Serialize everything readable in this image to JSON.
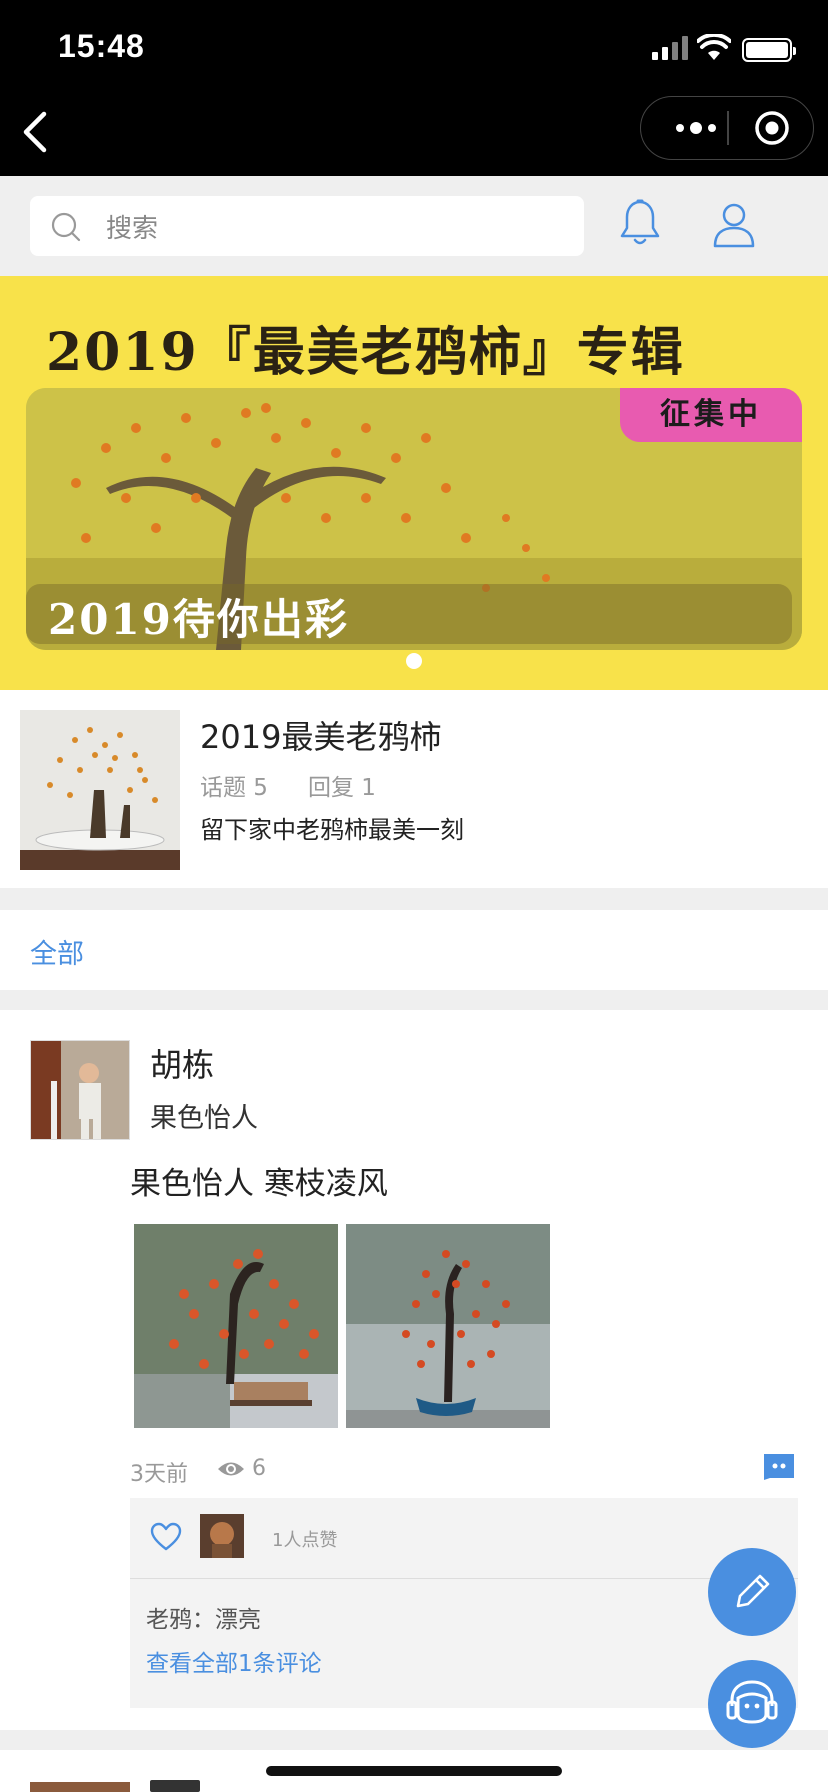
{
  "status_bar": {
    "time": "15:48"
  },
  "search": {
    "placeholder": "搜索"
  },
  "banner": {
    "title": "2019『最美老鸦柿』专辑",
    "tag": "征集中",
    "subtitle": "2019待你出彩"
  },
  "topic": {
    "title": "2019最美老鸦柿",
    "topics_label": "话题 5",
    "replies_label": "回复 1",
    "description": "留下家中老鸦柿最美一刻"
  },
  "filter": {
    "all_label": "全部"
  },
  "post": {
    "author": "胡栋",
    "subtitle": "果色怡人",
    "text": "果色怡人 寒枝凌风",
    "time": "3天前",
    "views": "6",
    "likes_text": "1人点赞",
    "comment_text": "老鸦：漂亮",
    "view_all_comments": "查看全部1条评论"
  },
  "icons": {
    "back": "chevron-left-icon",
    "more": "more-dots-icon",
    "close_target": "target-icon",
    "search": "search-icon",
    "bell": "bell-icon",
    "user": "user-icon",
    "eye": "eye-icon",
    "comment": "comment-icon",
    "heart": "heart-icon",
    "edit": "pencil-icon",
    "service": "customer-service-icon"
  },
  "colors": {
    "accent": "#4a8fe0",
    "banner_bg": "#f8e24a",
    "banner_tag": "#e85bb0",
    "meta_text": "#999999"
  }
}
